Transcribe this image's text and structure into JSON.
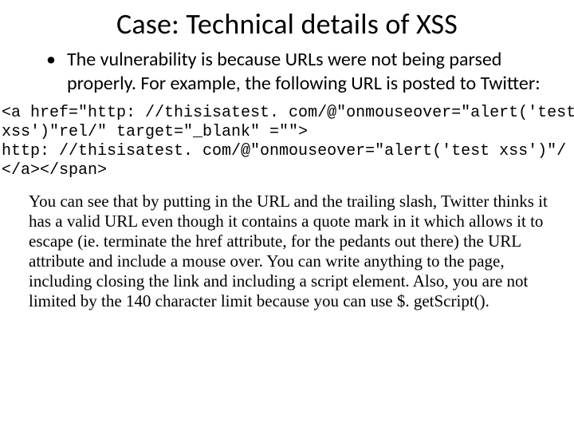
{
  "title": "Case: Technical details of XSS",
  "bullet": {
    "dot": "•",
    "text": "The vulnerability is because URLs were not being parsed properly. For example, the following URL is posted to Twitter:"
  },
  "code": {
    "line1": "<a href=\"http: //thisisatest. com/@\"onmouseover=\"alert('test",
    "line2": "xss')\"rel/\" target=\"_blank\" =\"\">",
    "line3": "http: //thisisatest. com/@\"onmouseover=\"alert('test xss')\"/",
    "line4": "</a></span>"
  },
  "explain": "You can see that by putting in the URL and the trailing slash, Twitter thinks it has a valid URL even though it contains a quote mark in it which allows it to escape (ie. terminate the href attribute, for the pedants out there) the URL attribute and include a mouse over. You can write anything to the page, including closing the link and including a script element. Also, you are not limited by the 140 character limit because you can use $. getScript()."
}
